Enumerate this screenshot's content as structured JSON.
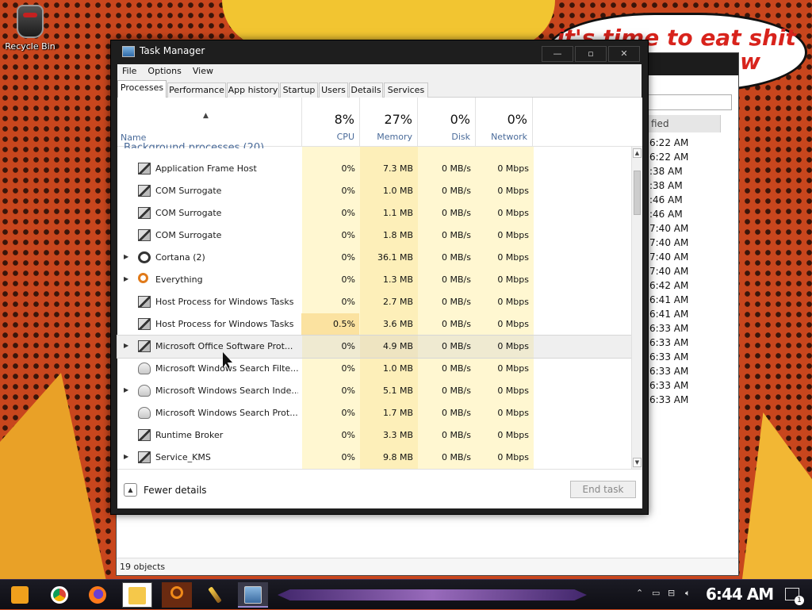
{
  "desktop": {
    "recycle_bin_label": "Recycle Bin",
    "bubble_line1": "it's time to eat shit",
    "bubble_line2": "w"
  },
  "explorer": {
    "column_header": "fied",
    "times": [
      "6:22 AM",
      "6:22 AM",
      ":38 AM",
      ":38 AM",
      ":46 AM",
      ":46 AM",
      "7:40 AM",
      "7:40 AM",
      "7:40 AM",
      "7:40 AM",
      "6:42 AM",
      "6:41 AM",
      "6:41 AM",
      "6:33 AM",
      "6:33 AM",
      "6:33 AM",
      "6:33 AM",
      "6:33 AM",
      "6:33 AM"
    ],
    "status": "19 objects"
  },
  "window": {
    "title": "Task Manager",
    "minimize": "—",
    "maximize": "▫",
    "close": "✕"
  },
  "menu": [
    "File",
    "Options",
    "View"
  ],
  "tabs": [
    "Processes",
    "Performance",
    "App history",
    "Startup",
    "Users",
    "Details",
    "Services"
  ],
  "active_tab": "Processes",
  "columns": {
    "name": "Name",
    "cpu": {
      "pct": "8%",
      "label": "CPU"
    },
    "memory": {
      "pct": "27%",
      "label": "Memory"
    },
    "disk": {
      "pct": "0%",
      "label": "Disk"
    },
    "network": {
      "pct": "0%",
      "label": "Network"
    }
  },
  "group_header": "Background processes (20)",
  "processes": [
    {
      "name": "Application Frame Host",
      "icon": "gear-icon",
      "expandable": false,
      "cpu": "0%",
      "memory": "7.3 MB",
      "disk": "0 MB/s",
      "network": "0 Mbps"
    },
    {
      "name": "COM Surrogate",
      "icon": "gear-icon",
      "expandable": false,
      "cpu": "0%",
      "memory": "1.0 MB",
      "disk": "0 MB/s",
      "network": "0 Mbps"
    },
    {
      "name": "COM Surrogate",
      "icon": "gear-icon",
      "expandable": false,
      "cpu": "0%",
      "memory": "1.1 MB",
      "disk": "0 MB/s",
      "network": "0 Mbps"
    },
    {
      "name": "COM Surrogate",
      "icon": "gear-icon",
      "expandable": false,
      "cpu": "0%",
      "memory": "1.8 MB",
      "disk": "0 MB/s",
      "network": "0 Mbps"
    },
    {
      "name": "Cortana (2)",
      "icon": "cortana-ring-icon",
      "expandable": true,
      "cpu": "0%",
      "memory": "36.1 MB",
      "disk": "0 MB/s",
      "network": "0 Mbps"
    },
    {
      "name": "Everything",
      "icon": "magnifier-icon",
      "expandable": true,
      "cpu": "0%",
      "memory": "1.3 MB",
      "disk": "0 MB/s",
      "network": "0 Mbps"
    },
    {
      "name": "Host Process for Windows Tasks",
      "icon": "gear-icon",
      "expandable": false,
      "cpu": "0%",
      "memory": "2.7 MB",
      "disk": "0 MB/s",
      "network": "0 Mbps"
    },
    {
      "name": "Host Process for Windows Tasks",
      "icon": "gear-icon",
      "expandable": false,
      "cpu": "0.5%",
      "memory": "3.6 MB",
      "disk": "0 MB/s",
      "network": "0 Mbps"
    },
    {
      "name": "Microsoft Office Software Prot...",
      "icon": "gear-icon",
      "expandable": true,
      "cpu": "0%",
      "memory": "4.9 MB",
      "disk": "0 MB/s",
      "network": "0 Mbps"
    },
    {
      "name": "Microsoft Windows Search Filte...",
      "icon": "user-search-icon",
      "expandable": false,
      "cpu": "0%",
      "memory": "1.0 MB",
      "disk": "0 MB/s",
      "network": "0 Mbps"
    },
    {
      "name": "Microsoft Windows Search Inde...",
      "icon": "user-search-icon",
      "expandable": true,
      "cpu": "0%",
      "memory": "5.1 MB",
      "disk": "0 MB/s",
      "network": "0 Mbps"
    },
    {
      "name": "Microsoft Windows Search Prot...",
      "icon": "user-search-icon",
      "expandable": false,
      "cpu": "0%",
      "memory": "1.7 MB",
      "disk": "0 MB/s",
      "network": "0 Mbps"
    },
    {
      "name": "Runtime Broker",
      "icon": "gear-icon",
      "expandable": false,
      "cpu": "0%",
      "memory": "3.3 MB",
      "disk": "0 MB/s",
      "network": "0 Mbps"
    },
    {
      "name": "Service_KMS",
      "icon": "gear-icon",
      "expandable": true,
      "cpu": "0%",
      "memory": "9.8 MB",
      "disk": "0 MB/s",
      "network": "0 Mbps"
    }
  ],
  "footer": {
    "fewer_details": "Fewer details",
    "end_task": "End task"
  },
  "taskbar": {
    "clock": "6:44 AM",
    "notification_count": "1"
  }
}
